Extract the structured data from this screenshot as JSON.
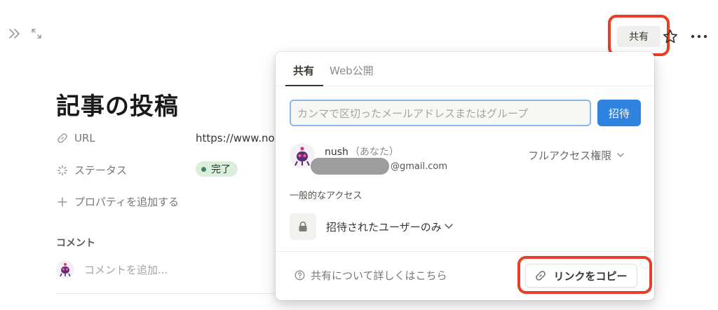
{
  "topbar": {
    "share_label": "共有"
  },
  "page": {
    "title": "記事の投稿",
    "properties": [
      {
        "name": "URL",
        "icon": "link-icon",
        "value": "https://www.no"
      },
      {
        "name": "ステータス",
        "icon": "loading-icon",
        "value": "完了"
      }
    ],
    "add_property_label": "プロパティを追加する",
    "comments_label": "コメント",
    "comment_placeholder": "コメントを追加..."
  },
  "share_popup": {
    "tabs": [
      "共有",
      "Web公開"
    ],
    "active_tab": "共有",
    "invite_placeholder": "カンマで区切ったメールアドレスまたはグループ",
    "invite_button": "招待",
    "user": {
      "name": "nush",
      "you_label": "（あなた）",
      "email_suffix": "@gmail.com",
      "access": "フルアクセス権限"
    },
    "general_access_label": "一般的なアクセス",
    "general_access_value": "招待されたユーザーのみ",
    "help_link": "共有について詳しくはこちら",
    "copy_link_button": "リンクをコピー"
  },
  "colors": {
    "highlight": "#e83d26",
    "primary_button": "#2f83df",
    "status_badge_bg": "#dbeddb",
    "status_dot": "#448361"
  }
}
